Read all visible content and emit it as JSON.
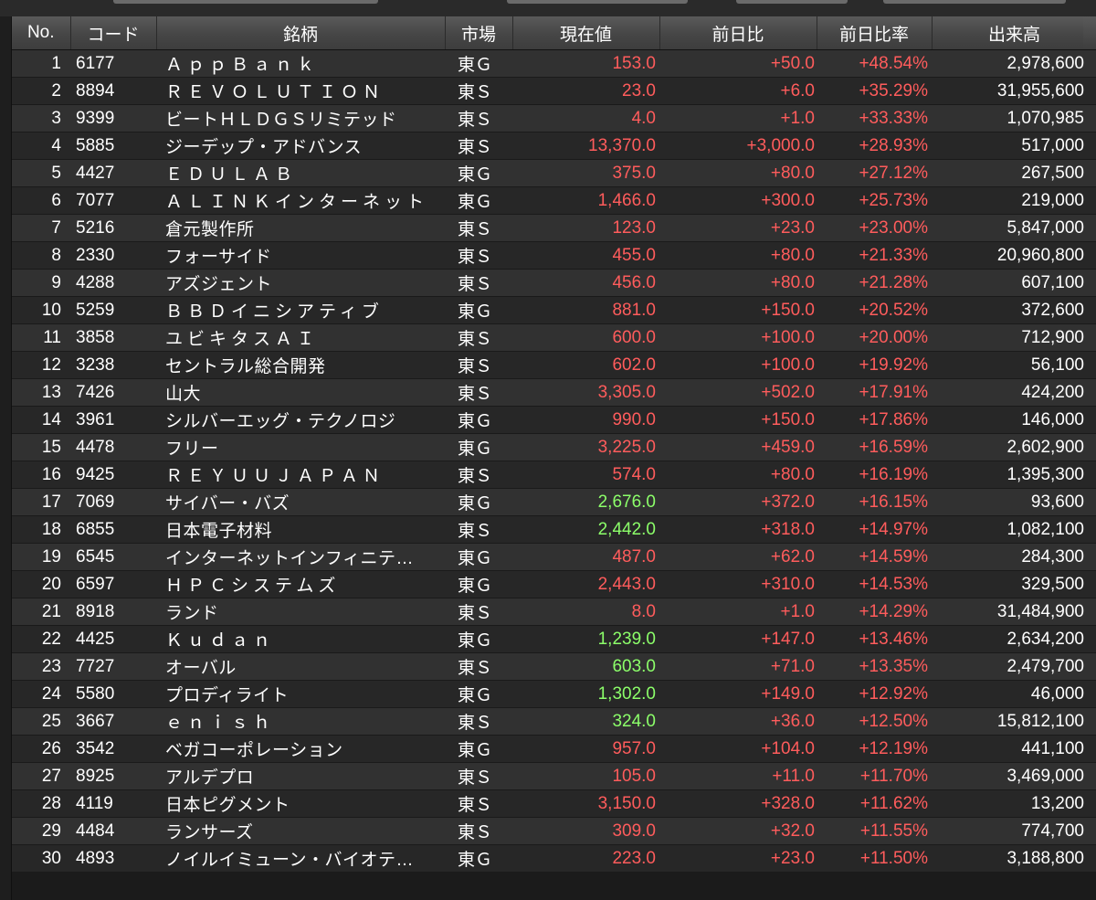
{
  "header": {
    "no": "No.",
    "code": "コード",
    "name": "銘柄",
    "market": "市場",
    "price": "現在値",
    "change": "前日比",
    "change_pct": "前日比率",
    "volume": "出来高"
  },
  "colors": {
    "background": "#1e1e1e",
    "row_odd": "#313131",
    "row_even": "#272727",
    "positive_text": "#ff5c5c",
    "highlight_price": "#8cff6a",
    "header_bg": "#4a4a4a",
    "text": "#ffffff"
  },
  "rows": [
    {
      "no": "1",
      "code": "6177",
      "name": "ＡｐｐＢａｎｋ",
      "market": "東Ｇ",
      "price": "153.0",
      "change": "+50.0",
      "pct": "+48.54%",
      "volume": "2,978,600",
      "highlight": false
    },
    {
      "no": "2",
      "code": "8894",
      "name": "ＲＥＶＯＬＵＴＩＯＮ",
      "market": "東Ｓ",
      "price": "23.0",
      "change": "+6.0",
      "pct": "+35.29%",
      "volume": "31,955,600",
      "highlight": false
    },
    {
      "no": "3",
      "code": "9399",
      "name": "ビートＨＬＤＧＳリミテッド",
      "market": "東Ｓ",
      "price": "4.0",
      "change": "+1.0",
      "pct": "+33.33%",
      "volume": "1,070,985",
      "highlight": false
    },
    {
      "no": "4",
      "code": "5885",
      "name": "ジーデップ・アドバンス",
      "market": "東Ｓ",
      "price": "13,370.0",
      "change": "+3,000.0",
      "pct": "+28.93%",
      "volume": "517,000",
      "highlight": false
    },
    {
      "no": "5",
      "code": "4427",
      "name": "ＥＤＵＬＡＢ",
      "market": "東Ｇ",
      "price": "375.0",
      "change": "+80.0",
      "pct": "+27.12%",
      "volume": "267,500",
      "highlight": false
    },
    {
      "no": "6",
      "code": "7077",
      "name": "ＡＬＩＮＫインターネット",
      "market": "東Ｇ",
      "price": "1,466.0",
      "change": "+300.0",
      "pct": "+25.73%",
      "volume": "219,000",
      "highlight": false
    },
    {
      "no": "7",
      "code": "5216",
      "name": "倉元製作所",
      "market": "東Ｓ",
      "price": "123.0",
      "change": "+23.0",
      "pct": "+23.00%",
      "volume": "5,847,000",
      "highlight": false
    },
    {
      "no": "8",
      "code": "2330",
      "name": "フォーサイド",
      "market": "東Ｓ",
      "price": "455.0",
      "change": "+80.0",
      "pct": "+21.33%",
      "volume": "20,960,800",
      "highlight": false
    },
    {
      "no": "9",
      "code": "4288",
      "name": "アズジェント",
      "market": "東Ｓ",
      "price": "456.0",
      "change": "+80.0",
      "pct": "+21.28%",
      "volume": "607,100",
      "highlight": false
    },
    {
      "no": "10",
      "code": "5259",
      "name": "ＢＢＤイニシアティブ",
      "market": "東Ｇ",
      "price": "881.0",
      "change": "+150.0",
      "pct": "+20.52%",
      "volume": "372,600",
      "highlight": false
    },
    {
      "no": "11",
      "code": "3858",
      "name": "ユビキタスＡＩ",
      "market": "東Ｓ",
      "price": "600.0",
      "change": "+100.0",
      "pct": "+20.00%",
      "volume": "712,900",
      "highlight": false
    },
    {
      "no": "12",
      "code": "3238",
      "name": "セントラル総合開発",
      "market": "東Ｓ",
      "price": "602.0",
      "change": "+100.0",
      "pct": "+19.92%",
      "volume": "56,100",
      "highlight": false
    },
    {
      "no": "13",
      "code": "7426",
      "name": "山大",
      "market": "東Ｓ",
      "price": "3,305.0",
      "change": "+502.0",
      "pct": "+17.91%",
      "volume": "424,200",
      "highlight": false
    },
    {
      "no": "14",
      "code": "3961",
      "name": "シルバーエッグ・テクノロジ",
      "market": "東Ｇ",
      "price": "990.0",
      "change": "+150.0",
      "pct": "+17.86%",
      "volume": "146,000",
      "highlight": false
    },
    {
      "no": "15",
      "code": "4478",
      "name": "フリー",
      "market": "東Ｇ",
      "price": "3,225.0",
      "change": "+459.0",
      "pct": "+16.59%",
      "volume": "2,602,900",
      "highlight": false
    },
    {
      "no": "16",
      "code": "9425",
      "name": "ＲＥＹＵＵＪＡＰＡＮ",
      "market": "東Ｓ",
      "price": "574.0",
      "change": "+80.0",
      "pct": "+16.19%",
      "volume": "1,395,300",
      "highlight": false
    },
    {
      "no": "17",
      "code": "7069",
      "name": "サイバー・バズ",
      "market": "東Ｇ",
      "price": "2,676.0",
      "change": "+372.0",
      "pct": "+16.15%",
      "volume": "93,600",
      "highlight": true
    },
    {
      "no": "18",
      "code": "6855",
      "name": "日本電子材料",
      "market": "東Ｓ",
      "price": "2,442.0",
      "change": "+318.0",
      "pct": "+14.97%",
      "volume": "1,082,100",
      "highlight": true
    },
    {
      "no": "19",
      "code": "6545",
      "name": "インターネットインフィニテ…",
      "market": "東Ｇ",
      "price": "487.0",
      "change": "+62.0",
      "pct": "+14.59%",
      "volume": "284,300",
      "highlight": false
    },
    {
      "no": "20",
      "code": "6597",
      "name": "ＨＰＣシステムズ",
      "market": "東Ｇ",
      "price": "2,443.0",
      "change": "+310.0",
      "pct": "+14.53%",
      "volume": "329,500",
      "highlight": false
    },
    {
      "no": "21",
      "code": "8918",
      "name": "ランド",
      "market": "東Ｓ",
      "price": "8.0",
      "change": "+1.0",
      "pct": "+14.29%",
      "volume": "31,484,900",
      "highlight": false
    },
    {
      "no": "22",
      "code": "4425",
      "name": "Ｋｕｄａｎ",
      "market": "東Ｇ",
      "price": "1,239.0",
      "change": "+147.0",
      "pct": "+13.46%",
      "volume": "2,634,200",
      "highlight": true
    },
    {
      "no": "23",
      "code": "7727",
      "name": "オーバル",
      "market": "東Ｓ",
      "price": "603.0",
      "change": "+71.0",
      "pct": "+13.35%",
      "volume": "2,479,700",
      "highlight": true
    },
    {
      "no": "24",
      "code": "5580",
      "name": "プロディライト",
      "market": "東Ｇ",
      "price": "1,302.0",
      "change": "+149.0",
      "pct": "+12.92%",
      "volume": "46,000",
      "highlight": true
    },
    {
      "no": "25",
      "code": "3667",
      "name": "ｅｎｉｓｈ",
      "market": "東Ｓ",
      "price": "324.0",
      "change": "+36.0",
      "pct": "+12.50%",
      "volume": "15,812,100",
      "highlight": true
    },
    {
      "no": "26",
      "code": "3542",
      "name": "ベガコーポレーション",
      "market": "東Ｇ",
      "price": "957.0",
      "change": "+104.0",
      "pct": "+12.19%",
      "volume": "441,100",
      "highlight": false
    },
    {
      "no": "27",
      "code": "8925",
      "name": "アルデプロ",
      "market": "東Ｓ",
      "price": "105.0",
      "change": "+11.0",
      "pct": "+11.70%",
      "volume": "3,469,000",
      "highlight": false
    },
    {
      "no": "28",
      "code": "4119",
      "name": "日本ピグメント",
      "market": "東Ｓ",
      "price": "3,150.0",
      "change": "+328.0",
      "pct": "+11.62%",
      "volume": "13,200",
      "highlight": false
    },
    {
      "no": "29",
      "code": "4484",
      "name": "ランサーズ",
      "market": "東Ｓ",
      "price": "309.0",
      "change": "+32.0",
      "pct": "+11.55%",
      "volume": "774,700",
      "highlight": false
    },
    {
      "no": "30",
      "code": "4893",
      "name": "ノイルイミューン・バイオテ…",
      "market": "東Ｇ",
      "price": "223.0",
      "change": "+23.0",
      "pct": "+11.50%",
      "volume": "3,188,800",
      "highlight": false
    }
  ]
}
